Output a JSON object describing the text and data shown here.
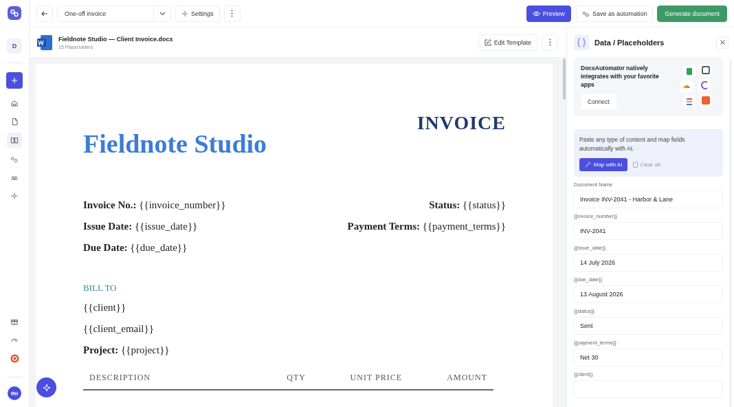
{
  "sidebar": {
    "workspace": "D",
    "nav": [
      {
        "kind": "home",
        "selected": false
      },
      {
        "kind": "document",
        "selected": false
      },
      {
        "kind": "book",
        "selected": true
      },
      {
        "kind": "gears",
        "selected": false
      },
      {
        "kind": "people",
        "selected": false
      },
      {
        "kind": "settings",
        "selected": false
      }
    ],
    "bottom": [
      {
        "kind": "gift"
      },
      {
        "kind": "gauge"
      },
      {
        "kind": "badge"
      }
    ],
    "avatar": "RH"
  },
  "toolbar": {
    "template": "One-off invoice",
    "settings": "Settings",
    "preview": "Preview",
    "save_automation": "Save as automation",
    "generate": "Generate document"
  },
  "document": {
    "file_name": "Fieldnote Studio — Client Invoice.docx",
    "placeholder_count": "15 Placeholders",
    "edit_button": "Edit Template",
    "company": "Fieldnote Studio",
    "title": "INVOICE",
    "left_fields": [
      {
        "label": "Invoice No.:",
        "value": "{{invoice_number}}"
      },
      {
        "label": "Issue Date:",
        "value": "{{issue_date}}"
      },
      {
        "label": "Due Date:",
        "value": "{{due_date}}"
      }
    ],
    "right_fields": [
      {
        "label": "Status:",
        "value": "{{status}}"
      },
      {
        "label": "Payment Terms:",
        "value": "{{payment_terms}}"
      }
    ],
    "bill_to": "BILL TO",
    "bill_lines": [
      "{{client}}",
      "{{client_email}}"
    ],
    "project": {
      "label": "Project:",
      "value": "{{project}}"
    },
    "columns": [
      "DESCRIPTION",
      "QTY",
      "UNIT PRICE",
      "AMOUNT"
    ]
  },
  "panel": {
    "title": "Data / Placeholders",
    "promo": "DocsAutomator natively integrates with your favorite apps",
    "connect": "Connect",
    "ai_text": "Paste any type of content and map fields automatically with AI.",
    "map_button": "Map with AI",
    "clear_button": "Clear all",
    "fields": [
      {
        "label": "Document Name",
        "value": "Invoice INV-2041 - Harbor & Lane"
      },
      {
        "label": "{{invoice_number}}",
        "value": "INV-2041"
      },
      {
        "label": "{{issue_date}}",
        "value": "14 July 2026"
      },
      {
        "label": "{{due_date}}",
        "value": "13 August 2026"
      },
      {
        "label": "{{status}}",
        "value": "Sent"
      },
      {
        "label": "{{payment_terms}}",
        "value": "Net 30"
      },
      {
        "label": "{{client}}"
      }
    ]
  }
}
